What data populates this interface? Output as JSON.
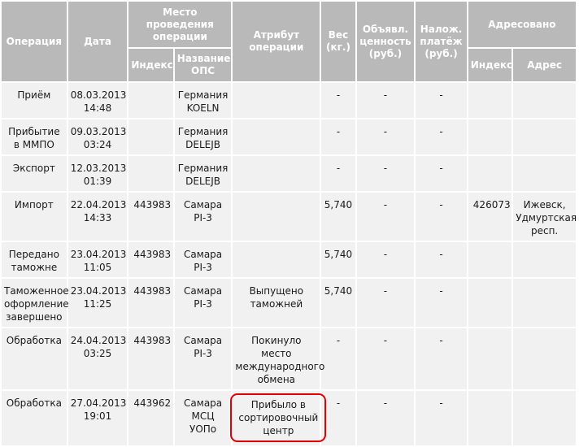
{
  "headers": {
    "operation": "Операция",
    "date": "Дата",
    "place": "Место проведения операции",
    "place_index": "Индекс",
    "place_name": "Название ОПС",
    "attribute": "Атрибут операции",
    "weight": "Вес (кг.)",
    "declared_value": "Объявл. ценность (руб.)",
    "cod": "Налож. платёж (руб.)",
    "addressed": "Адресовано",
    "addr_index": "Индекс",
    "addr_address": "Адрес"
  },
  "rows": [
    {
      "operation": "Приём",
      "date": "08.03.2013 14:48",
      "index": "",
      "ops": "Германия KOELN",
      "attribute": "",
      "weight": "-",
      "value": "-",
      "cod": "-",
      "addr_index": "",
      "address": ""
    },
    {
      "operation": "Прибытие в ММПО",
      "date": "09.03.2013 03:24",
      "index": "",
      "ops": "Германия DELEJB",
      "attribute": "",
      "weight": "-",
      "value": "-",
      "cod": "-",
      "addr_index": "",
      "address": ""
    },
    {
      "operation": "Экспорт",
      "date": "12.03.2013 01:39",
      "index": "",
      "ops": "Германия DELEJB",
      "attribute": "",
      "weight": "-",
      "value": "-",
      "cod": "-",
      "addr_index": "",
      "address": ""
    },
    {
      "operation": "Импорт",
      "date": "22.04.2013 14:33",
      "index": "443983",
      "ops": "Самара PI-3",
      "attribute": "",
      "weight": "5,740",
      "value": "-",
      "cod": "-",
      "addr_index": "426073",
      "address": "Ижевск, Удмуртская респ."
    },
    {
      "operation": "Передано таможне",
      "date": "23.04.2013 11:05",
      "index": "443983",
      "ops": "Самара PI-3",
      "attribute": "",
      "weight": "5,740",
      "value": "-",
      "cod": "-",
      "addr_index": "",
      "address": ""
    },
    {
      "operation": "Таможенное оформление завершено",
      "date": "23.04.2013 11:25",
      "index": "443983",
      "ops": "Самара PI-3",
      "attribute": "Выпущено таможней",
      "weight": "5,740",
      "value": "-",
      "cod": "-",
      "addr_index": "",
      "address": ""
    },
    {
      "operation": "Обработка",
      "date": "24.04.2013 03:25",
      "index": "443983",
      "ops": "Самара PI-3",
      "attribute": "Покинуло место международного обмена",
      "weight": "-",
      "value": "-",
      "cod": "-",
      "addr_index": "",
      "address": ""
    },
    {
      "operation": "Обработка",
      "date": "27.04.2013 19:01",
      "index": "443962",
      "ops": "Самара МСЦ УОПо",
      "attribute": "Прибыло в сортировочный центр",
      "weight": "-",
      "value": "-",
      "cod": "-",
      "addr_index": "",
      "address": ""
    }
  ],
  "highlight": {
    "row": 7,
    "column": "attribute",
    "color": "#e00000"
  },
  "colors": {
    "header_bg": "#b9b9b9",
    "cell_bg": "#f1f1f1"
  }
}
